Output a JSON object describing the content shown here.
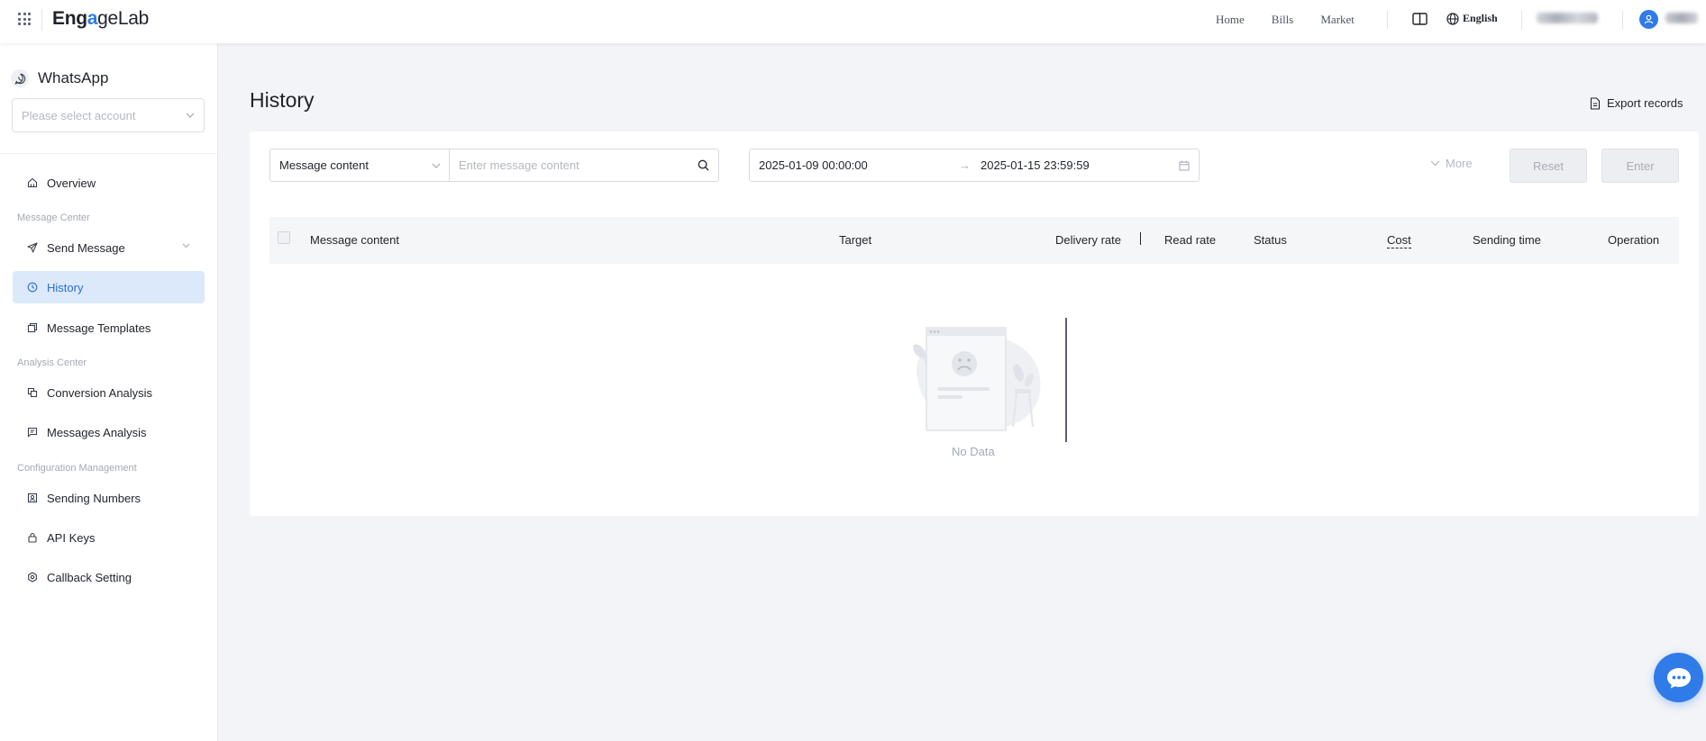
{
  "brand": {
    "part1": "Eng",
    "part2": "a",
    "part3": "geLab"
  },
  "topnav": {
    "home": "Home",
    "bills": "Bills",
    "market": "Market",
    "language": "English"
  },
  "sidebar": {
    "product": "WhatsApp",
    "account_placeholder": "Please select account",
    "items": {
      "overview": "Overview",
      "group_message_center": "Message Center",
      "send_message": "Send Message",
      "history": "History",
      "message_templates": "Message Templates",
      "group_analysis_center": "Analysis Center",
      "conversion_analysis": "Conversion Analysis",
      "messages_analysis": "Messages Analysis",
      "group_config": "Configuration Management",
      "sending_numbers": "Sending Numbers",
      "api_keys": "API Keys",
      "callback_setting": "Callback Setting"
    }
  },
  "main": {
    "title": "History",
    "export_label": "Export records"
  },
  "filters": {
    "type_value": "Message content",
    "search_placeholder": "Enter message content",
    "date_start": "2025-01-09 00:00:00",
    "date_arrow": "→",
    "date_end": "2025-01-15 23:59:59",
    "more_label": "More",
    "reset_label": "Reset",
    "enter_label": "Enter"
  },
  "table": {
    "columns": {
      "message_content": "Message content",
      "target": "Target",
      "delivery_rate": "Delivery rate",
      "read_rate": "Read rate",
      "status": "Status",
      "cost": "Cost",
      "sending_time": "Sending time",
      "operation": "Operation"
    },
    "empty_text": "No Data"
  },
  "colors": {
    "accent": "#2f7be8",
    "active_bg": "#dbe9fb",
    "page_bg": "#f3f4f7"
  }
}
